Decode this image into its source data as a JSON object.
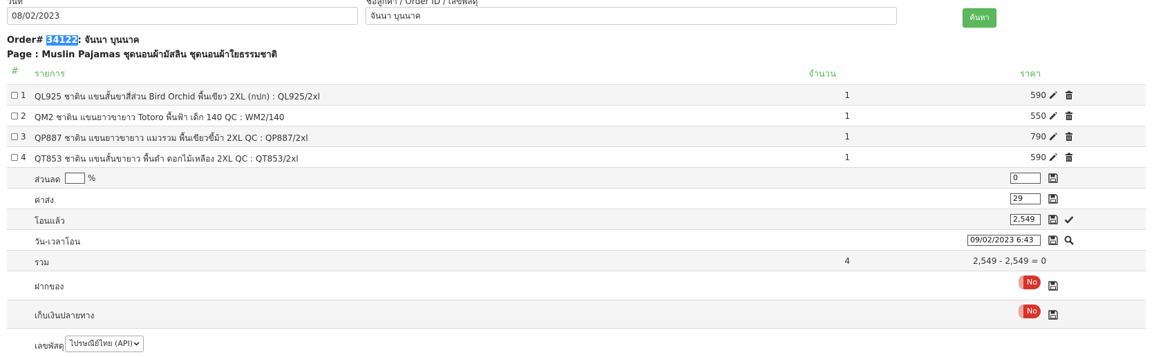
{
  "search": {
    "date_label": "วันที่",
    "date_value": "08/02/2023",
    "query_label": "ชื่อลูกค้า / Order ID / เลขพัสดุ",
    "query_value": "จันนา บุนนาค",
    "button_label": "ค้นหา"
  },
  "order": {
    "prefix": "Order#",
    "id": "34122",
    "customer": ": จันนา บุนนาค",
    "page": "Page : Muslin Pajamas ชุดนอนผ้ามัสลิน ชุดนอนผ้าใยธรรมชาติ"
  },
  "table": {
    "headers": {
      "num": "#",
      "item": "รายการ",
      "qty": "จำนวน",
      "price": "ราคา"
    },
    "items": [
      {
        "no": "1",
        "name": "QL925 ชาติน แขนสั้นขาสี่ส่วน Bird Orchid พื้นเขียว 2XL (กปก) : QL925/2xl",
        "qty": "1",
        "price": "590"
      },
      {
        "no": "2",
        "name": "QM2 ชาติน แขนยาวขายาว Totoro พื้นฟ้า เด็ก 140 QC : WM2/140",
        "qty": "1",
        "price": "550"
      },
      {
        "no": "3",
        "name": "QP887 ชาติน แขนยาวขายาว แมวรวม พื้นเขียวขี้ม้า 2XL QC : QP887/2xl",
        "qty": "1",
        "price": "790"
      },
      {
        "no": "4",
        "name": "QT853 ชาติน แขนสั้นขายาว พื้นดำ ดอกไม้เหลือง 2XL QC : QT853/2xl",
        "qty": "1",
        "price": "590"
      }
    ],
    "discount": {
      "label": "ส่วนลด",
      "percent_value": "",
      "percent_sign": "%",
      "value": "0"
    },
    "shipping": {
      "label": "ค่าส่ง",
      "value": "29"
    },
    "transferred": {
      "label": "โอนแล้ว",
      "value": "2,549"
    },
    "transfer_time": {
      "label": "วัน-เวลาโอน",
      "value": "09/02/2023 6:43"
    },
    "total": {
      "label": "รวม",
      "qty": "4",
      "summary": "2,549 - 2,549 = 0"
    },
    "deposit": {
      "label": "ฝากของ",
      "toggle": "No"
    },
    "cod": {
      "label": "เก็บเงินปลายทาง",
      "toggle": "No"
    },
    "tracking": {
      "label": "เลขพัสดุ",
      "carrier": "ไปรษณีย์ไทย (API)"
    }
  },
  "colors": {
    "accent": "#5cb85c",
    "toggle_off": "#d9342b",
    "highlight": "#3390ff"
  }
}
